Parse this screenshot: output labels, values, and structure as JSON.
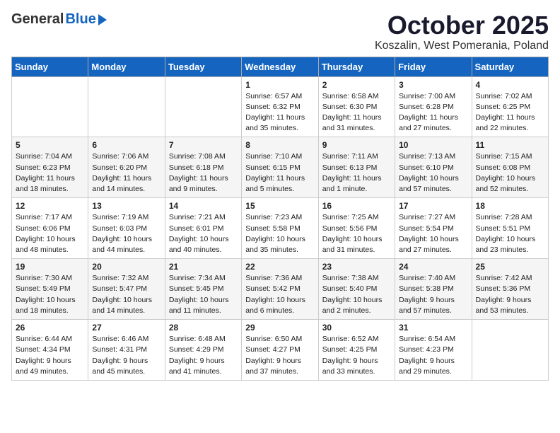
{
  "header": {
    "logo_general": "General",
    "logo_blue": "Blue",
    "month": "October 2025",
    "location": "Koszalin, West Pomerania, Poland"
  },
  "days_of_week": [
    "Sunday",
    "Monday",
    "Tuesday",
    "Wednesday",
    "Thursday",
    "Friday",
    "Saturday"
  ],
  "weeks": [
    [
      {
        "day": "",
        "info": ""
      },
      {
        "day": "",
        "info": ""
      },
      {
        "day": "",
        "info": ""
      },
      {
        "day": "1",
        "info": "Sunrise: 6:57 AM\nSunset: 6:32 PM\nDaylight: 11 hours\nand 35 minutes."
      },
      {
        "day": "2",
        "info": "Sunrise: 6:58 AM\nSunset: 6:30 PM\nDaylight: 11 hours\nand 31 minutes."
      },
      {
        "day": "3",
        "info": "Sunrise: 7:00 AM\nSunset: 6:28 PM\nDaylight: 11 hours\nand 27 minutes."
      },
      {
        "day": "4",
        "info": "Sunrise: 7:02 AM\nSunset: 6:25 PM\nDaylight: 11 hours\nand 22 minutes."
      }
    ],
    [
      {
        "day": "5",
        "info": "Sunrise: 7:04 AM\nSunset: 6:23 PM\nDaylight: 11 hours\nand 18 minutes."
      },
      {
        "day": "6",
        "info": "Sunrise: 7:06 AM\nSunset: 6:20 PM\nDaylight: 11 hours\nand 14 minutes."
      },
      {
        "day": "7",
        "info": "Sunrise: 7:08 AM\nSunset: 6:18 PM\nDaylight: 11 hours\nand 9 minutes."
      },
      {
        "day": "8",
        "info": "Sunrise: 7:10 AM\nSunset: 6:15 PM\nDaylight: 11 hours\nand 5 minutes."
      },
      {
        "day": "9",
        "info": "Sunrise: 7:11 AM\nSunset: 6:13 PM\nDaylight: 11 hours\nand 1 minute."
      },
      {
        "day": "10",
        "info": "Sunrise: 7:13 AM\nSunset: 6:10 PM\nDaylight: 10 hours\nand 57 minutes."
      },
      {
        "day": "11",
        "info": "Sunrise: 7:15 AM\nSunset: 6:08 PM\nDaylight: 10 hours\nand 52 minutes."
      }
    ],
    [
      {
        "day": "12",
        "info": "Sunrise: 7:17 AM\nSunset: 6:06 PM\nDaylight: 10 hours\nand 48 minutes."
      },
      {
        "day": "13",
        "info": "Sunrise: 7:19 AM\nSunset: 6:03 PM\nDaylight: 10 hours\nand 44 minutes."
      },
      {
        "day": "14",
        "info": "Sunrise: 7:21 AM\nSunset: 6:01 PM\nDaylight: 10 hours\nand 40 minutes."
      },
      {
        "day": "15",
        "info": "Sunrise: 7:23 AM\nSunset: 5:58 PM\nDaylight: 10 hours\nand 35 minutes."
      },
      {
        "day": "16",
        "info": "Sunrise: 7:25 AM\nSunset: 5:56 PM\nDaylight: 10 hours\nand 31 minutes."
      },
      {
        "day": "17",
        "info": "Sunrise: 7:27 AM\nSunset: 5:54 PM\nDaylight: 10 hours\nand 27 minutes."
      },
      {
        "day": "18",
        "info": "Sunrise: 7:28 AM\nSunset: 5:51 PM\nDaylight: 10 hours\nand 23 minutes."
      }
    ],
    [
      {
        "day": "19",
        "info": "Sunrise: 7:30 AM\nSunset: 5:49 PM\nDaylight: 10 hours\nand 18 minutes."
      },
      {
        "day": "20",
        "info": "Sunrise: 7:32 AM\nSunset: 5:47 PM\nDaylight: 10 hours\nand 14 minutes."
      },
      {
        "day": "21",
        "info": "Sunrise: 7:34 AM\nSunset: 5:45 PM\nDaylight: 10 hours\nand 11 minutes."
      },
      {
        "day": "22",
        "info": "Sunrise: 7:36 AM\nSunset: 5:42 PM\nDaylight: 10 hours\nand 6 minutes."
      },
      {
        "day": "23",
        "info": "Sunrise: 7:38 AM\nSunset: 5:40 PM\nDaylight: 10 hours\nand 2 minutes."
      },
      {
        "day": "24",
        "info": "Sunrise: 7:40 AM\nSunset: 5:38 PM\nDaylight: 9 hours\nand 57 minutes."
      },
      {
        "day": "25",
        "info": "Sunrise: 7:42 AM\nSunset: 5:36 PM\nDaylight: 9 hours\nand 53 minutes."
      }
    ],
    [
      {
        "day": "26",
        "info": "Sunrise: 6:44 AM\nSunset: 4:34 PM\nDaylight: 9 hours\nand 49 minutes."
      },
      {
        "day": "27",
        "info": "Sunrise: 6:46 AM\nSunset: 4:31 PM\nDaylight: 9 hours\nand 45 minutes."
      },
      {
        "day": "28",
        "info": "Sunrise: 6:48 AM\nSunset: 4:29 PM\nDaylight: 9 hours\nand 41 minutes."
      },
      {
        "day": "29",
        "info": "Sunrise: 6:50 AM\nSunset: 4:27 PM\nDaylight: 9 hours\nand 37 minutes."
      },
      {
        "day": "30",
        "info": "Sunrise: 6:52 AM\nSunset: 4:25 PM\nDaylight: 9 hours\nand 33 minutes."
      },
      {
        "day": "31",
        "info": "Sunrise: 6:54 AM\nSunset: 4:23 PM\nDaylight: 9 hours\nand 29 minutes."
      },
      {
        "day": "",
        "info": ""
      }
    ]
  ]
}
